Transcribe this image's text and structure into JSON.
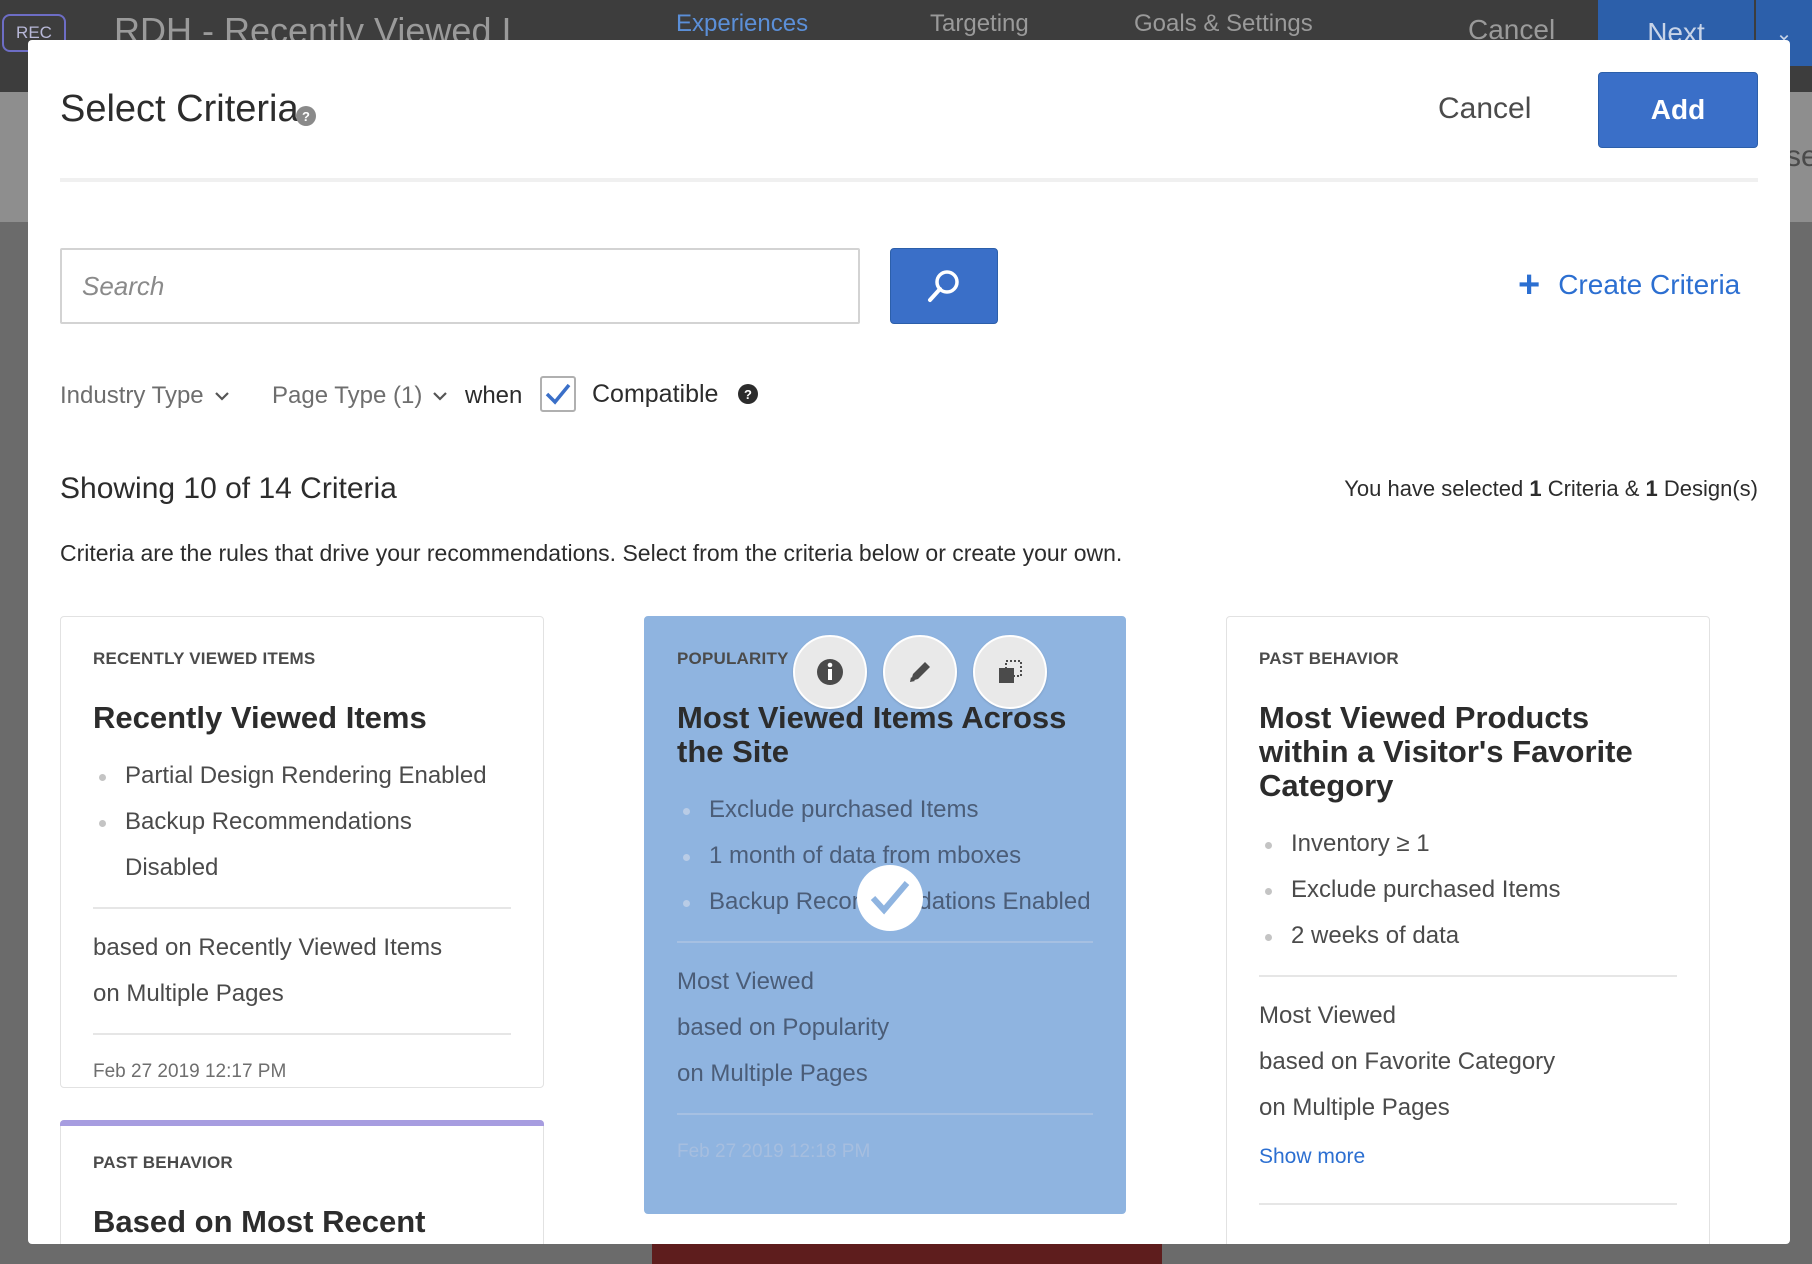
{
  "background": {
    "rec_badge": "REC",
    "activity_title": "RDH - Recently Viewed I",
    "tabs": [
      "Experiences",
      "Targeting",
      "Goals & Settings"
    ],
    "cancel_label": "Cancel",
    "next_label": "Next",
    "side_text": "se"
  },
  "modal": {
    "title": "Select Criteria",
    "help_icon": "question-circle-icon",
    "cancel_label": "Cancel",
    "add_label": "Add"
  },
  "search": {
    "placeholder": "Search",
    "value": ""
  },
  "create_criteria_label": "Create Criteria",
  "filters": {
    "industry_type": "Industry Type",
    "page_type": "Page Type (1)",
    "when_label": "when",
    "compatible_checked": true,
    "compatible_label": "Compatible"
  },
  "summary": {
    "showing": "Showing 10 of 14 Criteria",
    "selected_prefix": "You have selected ",
    "selected_criteria_count": "1",
    "selected_middle": " Criteria & ",
    "selected_design_count": "1",
    "selected_suffix": " Design(s)",
    "description": "Criteria are the rules that drive your recommendations. Select from the criteria below or create your own."
  },
  "cards": [
    {
      "category": "RECENTLY VIEWED ITEMS",
      "title": "Recently Viewed Items",
      "bullets": [
        "Partial Design Rendering Enabled",
        "Backup Recommendations Disabled"
      ],
      "based_on": [
        "based on Recently Viewed Items",
        "on Multiple Pages"
      ],
      "date": "Feb 27 2019 12:17 PM",
      "selected": false
    },
    {
      "category": "POPULARITY",
      "title": "Most Viewed Items Across the Site",
      "bullets": [
        "Exclude purchased Items",
        "1 month of data from mboxes",
        "Backup Recommendations Enabled"
      ],
      "based_on": [
        "Most Viewed",
        "based on Popularity",
        "on Multiple Pages"
      ],
      "date": "Feb 27 2019 12:18 PM",
      "selected": true
    },
    {
      "category": "PAST BEHAVIOR",
      "title": "Most Viewed Products within a Visitor's Favorite Category",
      "bullets": [
        "Inventory ≥ 1",
        "Exclude purchased Items",
        "2 weeks of data"
      ],
      "based_on": [
        "Most Viewed",
        "based on Favorite Category",
        "on Multiple Pages"
      ],
      "show_more": "Show more",
      "selected": false
    },
    {
      "category": "PAST BEHAVIOR",
      "title": "Based on Most Recent",
      "selected": false
    }
  ],
  "colors": {
    "accent": "#3a6fc8",
    "link": "#2c6fd1",
    "selected_card": "#8fb4e0",
    "top_bar": "#3d3d3d"
  }
}
